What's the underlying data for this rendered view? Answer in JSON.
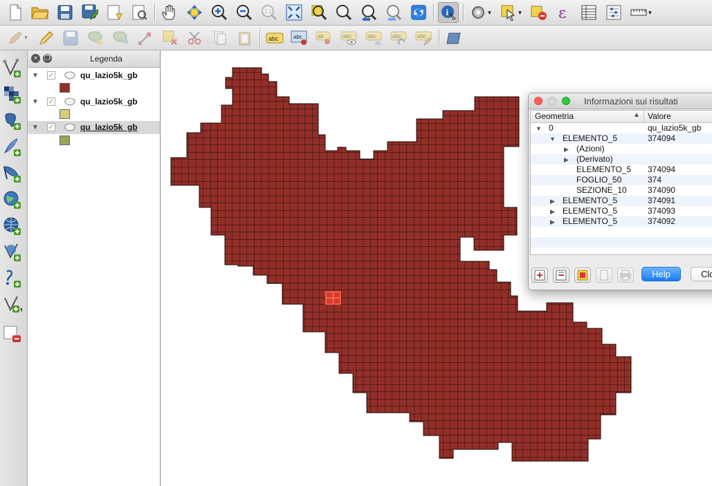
{
  "toolbar_main": {
    "icons": [
      "new-project-icon",
      "open-project-icon",
      "save-project-icon",
      "save-as-icon",
      "new-print-composer-icon",
      "composer-manager-icon",
      "pan-icon",
      "pan-to-selection-icon",
      "zoom-in-icon",
      "zoom-out-icon",
      "zoom-native-icon",
      "zoom-full-icon",
      "zoom-to-selection-icon",
      "zoom-to-layer-icon",
      "zoom-last-icon",
      "zoom-next-icon",
      "refresh-icon",
      "identify-icon",
      "processing-icon",
      "select-features-icon",
      "deselect-icon",
      "expression-select-icon",
      "attribute-table-icon",
      "statistics-icon",
      "measure-icon"
    ]
  },
  "toolbar_edit": {
    "icons": [
      "current-edits-icon",
      "toggle-editing-icon",
      "save-edits-icon",
      "add-feature-icon",
      "move-feature-icon",
      "node-tool-icon",
      "delete-selected-icon",
      "cut-features-icon",
      "copy-features-icon",
      "paste-features-icon",
      "label-abc-icon",
      "layer-labeling-icon",
      "pin-labels-icon",
      "show-hide-labels-icon",
      "move-label-icon",
      "rotate-label-icon",
      "change-label-icon",
      "shape-icon"
    ]
  },
  "left_toolbar": {
    "icons": [
      "add-vector-layer-icon",
      "add-raster-layer-icon",
      "add-postgis-layer-icon",
      "add-spatialite-layer-icon",
      "add-mssql-layer-icon",
      "add-wms-layer-icon",
      "add-wcs-layer-icon",
      "add-wfs-layer-icon",
      "add-delimited-text-icon",
      "new-shapefile-icon",
      "remove-layer-icon"
    ]
  },
  "legend": {
    "title": "Legenda",
    "layers": [
      {
        "name": "qu_lazio5k_gb",
        "color": "#922f28",
        "selected": false
      },
      {
        "name": "qu_lazio5k_gb",
        "color": "#d8cc7c",
        "selected": false
      },
      {
        "name": "qu_lazio5k_gb",
        "color": "#9aa55a",
        "selected": true
      }
    ]
  },
  "map": {
    "fill_color": "#922f28",
    "highlight_color": "#d83a2e"
  },
  "dialog": {
    "title": "Informazioni sui risultati",
    "col_geometry": "Geometria",
    "col_value": "Valore",
    "rows": [
      {
        "key": "0",
        "value": "qu_lazio5k_gb"
      },
      {
        "key": "ELEMENTO_5",
        "value": "374094"
      },
      {
        "key": "(Azioni)",
        "value": ""
      },
      {
        "key": "(Derivato)",
        "value": ""
      },
      {
        "key": "ELEMENTO_5",
        "value": "374094"
      },
      {
        "key": "FOGLIO_50",
        "value": "374"
      },
      {
        "key": "SEZIONE_10",
        "value": "374090"
      },
      {
        "key": "ELEMENTO_5",
        "value": "374091"
      },
      {
        "key": "ELEMENTO_5",
        "value": "374093"
      },
      {
        "key": "ELEMENTO_5",
        "value": "374092"
      }
    ],
    "help_label": "Help",
    "close_label": "Clo"
  }
}
